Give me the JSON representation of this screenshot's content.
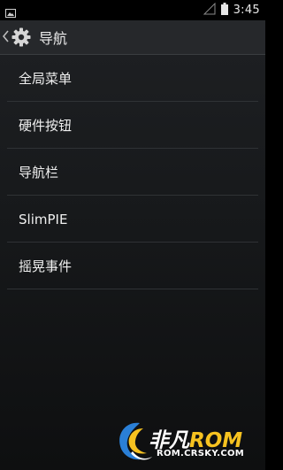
{
  "status_bar": {
    "time": "3:45",
    "icons": [
      "image-notification-icon",
      "signal-icon",
      "battery-icon"
    ]
  },
  "action_bar": {
    "title": "导航",
    "icons": [
      "back-chevron-icon",
      "settings-gear-icon"
    ]
  },
  "list": {
    "items": [
      {
        "label": "全局菜单"
      },
      {
        "label": "硬件按钮"
      },
      {
        "label": "导航栏"
      },
      {
        "label": "SlimPIE"
      },
      {
        "label": "摇晃事件"
      }
    ]
  },
  "watermark": {
    "brand_cn": "非凡",
    "brand_rom": "ROM",
    "url": "ROM.CRSKY.COM"
  },
  "colors": {
    "background": "#17191b",
    "action_bar": "#26282b",
    "text": "#f0f0f0",
    "watermark_accent": "#f6c220",
    "watermark_swirl_blue": "#2a7fd6"
  }
}
